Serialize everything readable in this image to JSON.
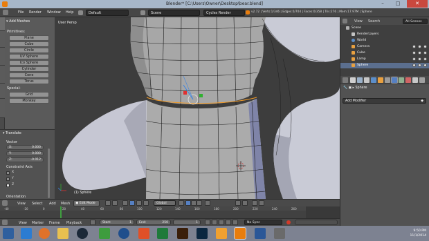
{
  "window": {
    "title": "Blender* [C:\\Users\\Owner\\Desktop\\bear.blend]",
    "controls": {
      "minimize": "–",
      "maximize": "□",
      "close": "✕"
    }
  },
  "infobar": {
    "menus": [
      "File",
      "Render",
      "Window",
      "Help"
    ],
    "layout": "Default",
    "scene": "Scene",
    "engine": "Cycles Render",
    "stats": "v2.72 | Verts:1/346 | Edges:0/704 | Faces:0/358 | Tris:276 | Mem:17.97M | Sphere"
  },
  "toolshelf": {
    "vtabs": [
      "Tools",
      "Create",
      "Relations",
      "Animation",
      "Physics",
      "Grease Pencil",
      "Options"
    ],
    "header": "Add Meshes",
    "primitives_label": "Primitives:",
    "primitives": [
      "Plane",
      "Cube",
      "Circle",
      "UV Sphere",
      "Ico Sphere",
      "Cylinder",
      "Cone",
      "Torus"
    ],
    "special_label": "Special:",
    "special": [
      "Grid",
      "Monkey"
    ]
  },
  "redo_panel": {
    "header": "Translate",
    "vector_label": "Vector",
    "x": {
      "label": "X:",
      "value": "0.000"
    },
    "y": {
      "label": "Y:",
      "value": "0.000"
    },
    "z": {
      "label": "Z:",
      "value": "-0.012"
    },
    "constraint_label": "Constraint Axis",
    "axes": [
      "X",
      "Y",
      "Z"
    ],
    "orientation_label": "Orientation"
  },
  "viewport": {
    "view_label": "User Persp",
    "object_label": "(1) Sphere"
  },
  "viewport_header": {
    "menus": [
      "View",
      "Select",
      "Add",
      "Mesh"
    ],
    "mode": "Edit Mode",
    "orientation": "Global"
  },
  "timeline": {
    "ticks": [
      "-40",
      "-20",
      "0",
      "20",
      "40",
      "60",
      "80",
      "100",
      "120",
      "140",
      "160",
      "180",
      "200",
      "220",
      "240",
      "260"
    ],
    "current_frame": "1",
    "menus": [
      "View",
      "Marker",
      "Frame",
      "Playback"
    ],
    "start": {
      "label": "Start:",
      "value": "1"
    },
    "end": {
      "label": "End:",
      "value": "250"
    },
    "frame_value": "1",
    "sync": "No Sync"
  },
  "outliner": {
    "menus": [
      "View",
      "Search"
    ],
    "filter": "All Scenes",
    "items": [
      "Scene",
      "RenderLayers",
      "World",
      "Camera",
      "Cube",
      "Lamp",
      "Sphere"
    ]
  },
  "properties": {
    "path": "Sphere",
    "add_modifier": "Add Modifier"
  },
  "taskbar": {
    "apps": [
      "start",
      "ie",
      "firefox",
      "explorer",
      "steam",
      "chrome",
      "hp",
      "office",
      "excel",
      "illustrator",
      "photoshop",
      "vlc",
      "blender",
      "word",
      "calc"
    ],
    "time": "9:50 PM",
    "date": "11/1/2014"
  },
  "colors": {
    "selection": "#f09a27",
    "mesh_face": "#a9a9a9",
    "wire": "#1a1a1a",
    "accent_blue": "#5680c2"
  }
}
